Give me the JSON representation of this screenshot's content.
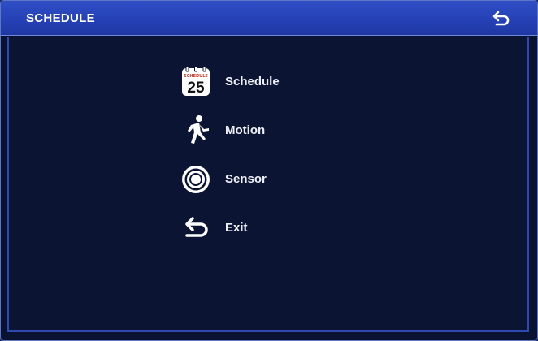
{
  "window": {
    "title": "SCHEDULE"
  },
  "menu": {
    "items": [
      {
        "label": "Schedule",
        "icon": "calendar-icon",
        "calendar_header": "SCHEDULE",
        "calendar_day": "25"
      },
      {
        "label": "Motion",
        "icon": "motion-person-icon"
      },
      {
        "label": "Sensor",
        "icon": "sensor-icon"
      },
      {
        "label": "Exit",
        "icon": "return-arrow-icon"
      }
    ]
  },
  "colors": {
    "titlebar": "#2540b4",
    "background": "#0a1232",
    "frame_border": "#2e49b0",
    "text": "#ffffff"
  }
}
